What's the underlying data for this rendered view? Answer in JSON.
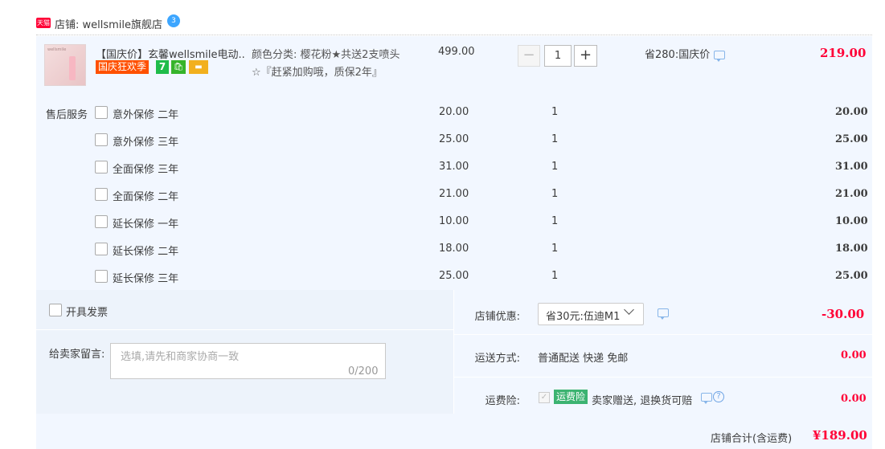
{
  "shop": {
    "badge": "天猫",
    "title": "店铺: wellsmile旗舰店",
    "chat_badge": "3"
  },
  "item": {
    "thumb_text": "wellsmile",
    "title": "【国庆价】玄馨wellsmile电动...",
    "promo": "国庆狂欢季",
    "icon_7": "7",
    "icon_bag": "🛍",
    "icon_card": "▬",
    "sku_line1": "颜色分类: 樱花粉★共送2支喷头",
    "sku_line2": "☆『赶紧加购哦，质保2年』",
    "unit_price": "499.00",
    "qty_minus": "−",
    "qty": "1",
    "qty_plus": "+",
    "saving": "省280:国庆价",
    "total": "219.00"
  },
  "services": {
    "label": "售后服务",
    "rows": [
      {
        "name": "意外保修 二年",
        "price": "20.00",
        "qty": "1",
        "total": "20.00"
      },
      {
        "name": "意外保修 三年",
        "price": "25.00",
        "qty": "1",
        "total": "25.00"
      },
      {
        "name": "全面保修 三年",
        "price": "31.00",
        "qty": "1",
        "total": "31.00"
      },
      {
        "name": "全面保修 二年",
        "price": "21.00",
        "qty": "1",
        "total": "21.00"
      },
      {
        "name": "延长保修 一年",
        "price": "10.00",
        "qty": "1",
        "total": "10.00"
      },
      {
        "name": "延长保修 二年",
        "price": "18.00",
        "qty": "1",
        "total": "18.00"
      },
      {
        "name": "延长保修 三年",
        "price": "25.00",
        "qty": "1",
        "total": "25.00"
      }
    ]
  },
  "invoice": {
    "label": "开具发票"
  },
  "message": {
    "label": "给卖家留言:",
    "placeholder": "选填,请先和商家协商一致",
    "count": "0/200"
  },
  "coupon": {
    "label": "店铺优惠:",
    "selected": "省30元:伍迪M1",
    "amount": "-30.00"
  },
  "shipping": {
    "label": "运送方式:",
    "value": "普通配送 快递 免邮",
    "fee": "0.00"
  },
  "insurance": {
    "label": "运费险:",
    "check": "✓",
    "badge": "运费险",
    "text": "卖家赠送, 退换货可赔",
    "help": "?",
    "fee": "0.00"
  },
  "shop_total": {
    "label": "店铺合计(含运费)",
    "value": "¥189.00"
  }
}
